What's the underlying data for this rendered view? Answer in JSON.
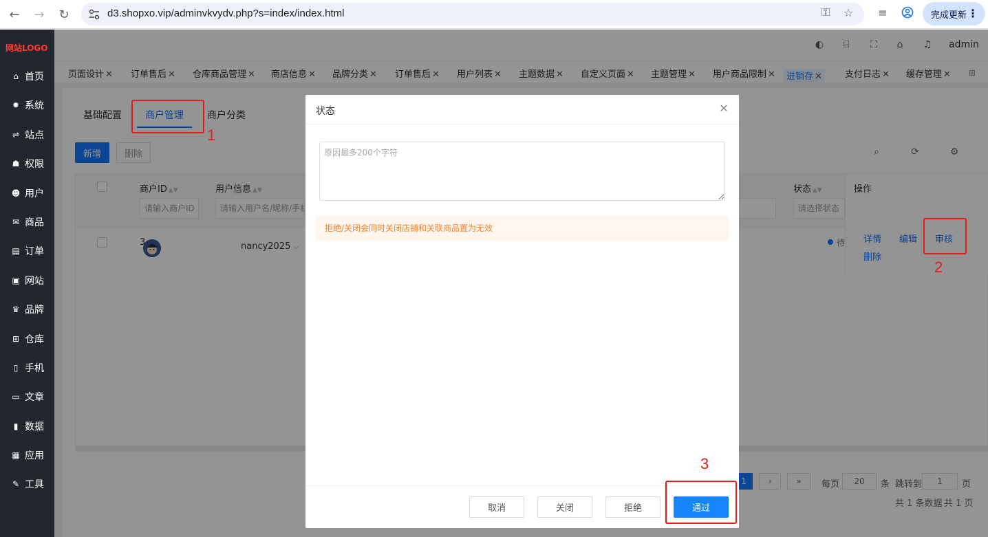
{
  "browser": {
    "url": "d3.shopxo.vip/adminvkvydv.php?s=index/index.html",
    "update_label": "完成更新"
  },
  "sidebar": {
    "logo": "网站LOGO",
    "items": [
      {
        "label": "首页",
        "icon": "home-icon"
      },
      {
        "label": "系统",
        "icon": "gear-icon"
      },
      {
        "label": "站点",
        "icon": "sliders-icon"
      },
      {
        "label": "权限",
        "icon": "user-lock-icon"
      },
      {
        "label": "用户",
        "icon": "user-icon"
      },
      {
        "label": "商品",
        "icon": "mail-icon"
      },
      {
        "label": "订单",
        "icon": "order-icon"
      },
      {
        "label": "网站",
        "icon": "chat-icon"
      },
      {
        "label": "品牌",
        "icon": "brand-icon"
      },
      {
        "label": "仓库",
        "icon": "warehouse-icon"
      },
      {
        "label": "手机",
        "icon": "mobile-icon"
      },
      {
        "label": "文章",
        "icon": "article-icon"
      },
      {
        "label": "数据",
        "icon": "chart-icon"
      },
      {
        "label": "应用",
        "icon": "apps-icon"
      },
      {
        "label": "工具",
        "icon": "wrench-icon"
      }
    ]
  },
  "header": {
    "user": "admin"
  },
  "tabs": [
    {
      "label": "页面设计"
    },
    {
      "label": "订单售后"
    },
    {
      "label": "仓库商品管理"
    },
    {
      "label": "商店信息"
    },
    {
      "label": "品牌分类"
    },
    {
      "label": "订单售后"
    },
    {
      "label": "用户列表"
    },
    {
      "label": "主题数据"
    },
    {
      "label": "自定义页面"
    },
    {
      "label": "主题管理"
    },
    {
      "label": "用户商品限制"
    },
    {
      "label": "进销存"
    },
    {
      "label": "支付日志"
    },
    {
      "label": "缓存管理"
    }
  ],
  "subtabs": [
    "基础配置",
    "商户管理",
    "商户分类"
  ],
  "toolbar": {
    "new_label": "新增",
    "delete_label": "删除"
  },
  "table": {
    "columns": {
      "merchant_id": "商户ID",
      "user_info": "用户信息",
      "status": "状态",
      "ops": "操作"
    },
    "filters": {
      "merchant_id": "请输入商户ID",
      "user_info": "请输入用户名/昵称/手机",
      "status": "请选择状态"
    },
    "rows": [
      {
        "id": "3",
        "username": "nancy2025",
        "status_char": "待"
      }
    ],
    "ops": {
      "detail": "详情",
      "edit": "编辑",
      "audit": "审核",
      "delete": "删除"
    }
  },
  "pager": {
    "current": "1",
    "next": "›",
    "last": "»",
    "per_page_label": "每页",
    "per_page": "20",
    "unit": "条",
    "jump_label": "跳转到",
    "jump_value": "1",
    "page_unit": "页",
    "total_text": "共 1 条数据",
    "pages_text": "共 1 页"
  },
  "modal": {
    "title": "状态",
    "placeholder": "原因最多200个字符",
    "warning": "拒绝/关闭会同时关闭店铺和关联商品置为无效",
    "cancel": "取消",
    "close": "关闭",
    "reject": "拒绝",
    "approve": "通过"
  },
  "annotations": {
    "n1": "1",
    "n2": "2",
    "n3": "3",
    "color": "#e21b1b"
  }
}
